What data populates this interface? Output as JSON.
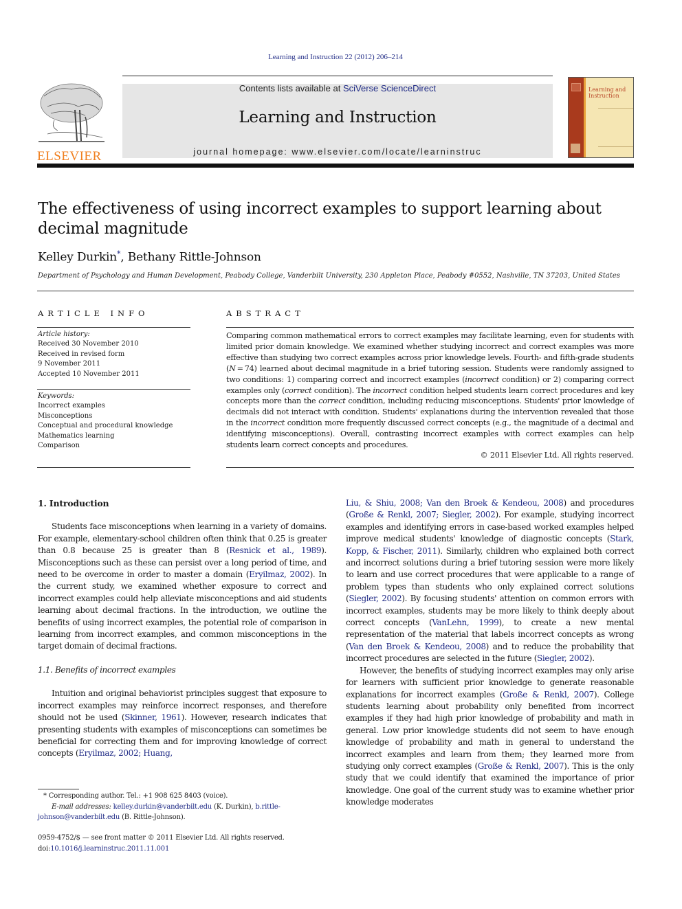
{
  "header": {
    "citation": "Learning and Instruction 22 (2012) 206–214",
    "contents_prefix": "Contents lists available at ",
    "contents_link": "SciVerse ScienceDirect",
    "journal_title": "Learning and Instruction",
    "homepage": "journal homepage: www.elsevier.com/locate/learninstruc",
    "publisher_logo": "ELSEVIER",
    "cover_title_line1": "Learning and",
    "cover_title_line2": "Instruction",
    "colors": {
      "elsevier_orange": "#f07f1f",
      "link_blue": "#1f2a85",
      "banner_gray": "#e6e6e6",
      "cover_spine": "#a93a1d",
      "cover_bg": "#f5e6b3"
    }
  },
  "article": {
    "title": "The effectiveness of using incorrect examples to support learning about decimal magnitude",
    "author1": "Kelley Durkin",
    "author1_mark": "*",
    "author_sep": ", ",
    "author2": "Bethany Rittle-Johnson",
    "affiliation": "Department of Psychology and Human Development, Peabody College, Vanderbilt University, 230 Appleton Place, Peabody #0552, Nashville, TN 37203, United States"
  },
  "article_info": {
    "heading": "ARTICLE INFO",
    "history_label": "Article history:",
    "history": [
      "Received 30 November 2010",
      "Received in revised form",
      "9 November 2011",
      "Accepted 10 November 2011"
    ],
    "keywords_label": "Keywords:",
    "keywords": [
      "Incorrect examples",
      "Misconceptions",
      "Conceptual and procedural knowledge",
      "Mathematics learning",
      "Comparison"
    ]
  },
  "abstract": {
    "heading": "ABSTRACT",
    "s1": "Comparing common mathematical errors to correct examples may facilitate learning, even for students with limited prior domain knowledge. We examined whether studying incorrect and correct examples was more effective than studying two correct examples across prior knowledge levels. Fourth- and fifth-grade students (",
    "n_var": "N",
    "s2": " = 74) learned about decimal magnitude in a brief tutoring session. Students were randomly assigned to two conditions: 1) comparing correct and incorrect examples (",
    "i_incorrect": "incorrect",
    "s3": " condition) or 2) comparing correct examples only (",
    "i_correct": "correct",
    "s4": " condition). The ",
    "s5": " condition helped students learn correct procedures and key concepts more than the ",
    "s6": " condition, including reducing misconceptions. Students' prior knowledge of decimals did not interact with condition. Students' explanations during the intervention revealed that those in the ",
    "s7": " condition more frequently discussed correct concepts (e.g., the magnitude of a decimal and identifying misconceptions). Overall, contrasting incorrect examples with correct examples can help students learn correct concepts and procedures.",
    "copyright": "© 2011 Elsevier Ltd. All rights reserved."
  },
  "body": {
    "intro_heading": "1.  Introduction",
    "p1": {
      "a": "Students face misconceptions when learning in a variety of domains. For example, elementary-school children often think that 0.25 is greater than 0.8 because 25 is greater than 8 (",
      "ref1": "Resnick et al., 1989",
      "b": "). Misconceptions such as these can persist over a long period of time, and need to be overcome in order to master a domain (",
      "ref2": "Eryilmaz, 2002",
      "c": "). In the current study, we examined whether exposure to correct and incorrect examples could help alleviate misconceptions and aid students learning about decimal fractions. In the introduction, we outline the benefits of using incorrect examples, the potential role of comparison in learning from incorrect examples, and common misconceptions in the target domain of decimal fractions."
    },
    "sub_heading": "1.1.  Benefits of incorrect examples",
    "p2": {
      "a": "Intuition and original behaviorist principles suggest that exposure to incorrect examples may reinforce incorrect responses, and therefore should not be used (",
      "ref1": "Skinner, 1961",
      "b": "). However, research indicates that presenting students with examples of misconceptions can sometimes be beneficial for correcting them and for improving knowledge of correct concepts (",
      "ref2": "Eryilmaz, 2002; Huang,"
    },
    "p2_cont": {
      "ref1": "Liu, & Shiu, 2008; Van den Broek & Kendeou, 2008",
      "a": ") and procedures (",
      "ref2": "Große & Renkl, 2007; Siegler, 2002",
      "b": "). For example, studying incorrect examples and identifying errors in case-based worked examples helped improve medical students' knowledge of diagnostic concepts (",
      "ref3": "Stark, Kopp, & Fischer, 2011",
      "c": "). Similarly, children who explained both correct and incorrect solutions during a brief tutoring session were more likely to learn and use correct procedures that were applicable to a range of problem types than students who only explained correct solutions (",
      "ref4": "Siegler, 2002",
      "d": "). By focusing students' attention on common errors with incorrect examples, students may be more likely to think deeply about correct concepts (",
      "ref5": "VanLehn, 1999",
      "e": "), to create a new mental representation of the material that labels incorrect concepts as wrong (",
      "ref6": "Van den Broek & Kendeou, 2008",
      "f": ") and to reduce the probability that incorrect procedures are selected in the future (",
      "ref7": "Siegler, 2002",
      "g": ")."
    },
    "p3": {
      "a": "However, the benefits of studying incorrect examples may only arise for learners with sufficient prior knowledge to generate reasonable explanations for incorrect examples (",
      "ref1": "Große & Renkl, 2007",
      "b": "). College students learning about probability only benefited from incorrect examples if they had high prior knowledge of probability and math in general. Low prior knowledge students did not seem to have enough knowledge of probability and math in general to understand the incorrect examples and learn from them; they learned more from studying only correct examples (",
      "ref2": "Große & Renkl, 2007",
      "c": "). This is the only study that we could identify that examined the importance of prior knowledge. One goal of the current study was to examine whether prior knowledge moderates"
    }
  },
  "footnotes": {
    "star": "*",
    "corresponding": " Corresponding author. Tel.: +1 908 625 8403 (voice).",
    "email_label": "E-mail addresses:",
    "email1": "kelley.durkin@vanderbilt.edu",
    "email1_name": " (K. Durkin), ",
    "email2": "b.rittle-johnson@vanderbilt.edu",
    "email2_name": " (B. Rittle-Johnson)."
  },
  "imprint": {
    "issn": "0959-4752/$ — see front matter © 2011 Elsevier Ltd. All rights reserved.",
    "doi_label": "doi:",
    "doi": "10.1016/j.learninstruc.2011.11.001"
  }
}
